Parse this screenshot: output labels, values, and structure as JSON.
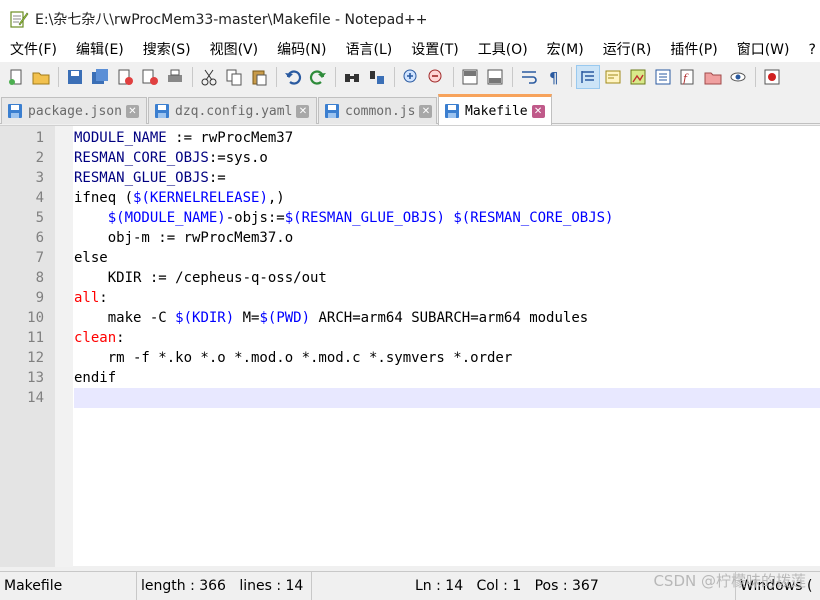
{
  "window": {
    "title": "E:\\杂七杂八\\rwProcMem33-master\\Makefile - Notepad++"
  },
  "menu": [
    {
      "label": "文件(F)"
    },
    {
      "label": "编辑(E)"
    },
    {
      "label": "搜索(S)"
    },
    {
      "label": "视图(V)"
    },
    {
      "label": "编码(N)"
    },
    {
      "label": "语言(L)"
    },
    {
      "label": "设置(T)"
    },
    {
      "label": "工具(O)"
    },
    {
      "label": "宏(M)"
    },
    {
      "label": "运行(R)"
    },
    {
      "label": "插件(P)"
    },
    {
      "label": "窗口(W)"
    },
    {
      "label": "?"
    }
  ],
  "toolbar": [
    {
      "icon": "new-file-icon"
    },
    {
      "icon": "open-folder-icon"
    },
    {
      "icon": "save-icon"
    },
    {
      "icon": "save-all-icon"
    },
    {
      "icon": "close-file-icon"
    },
    {
      "icon": "close-all-icon"
    },
    {
      "icon": "print-icon"
    },
    {
      "icon": "cut-icon"
    },
    {
      "icon": "copy-icon"
    },
    {
      "icon": "paste-icon"
    },
    {
      "icon": "undo-icon"
    },
    {
      "icon": "redo-icon"
    },
    {
      "icon": "find-icon"
    },
    {
      "icon": "replace-icon"
    },
    {
      "icon": "zoom-in-icon"
    },
    {
      "icon": "zoom-out-icon"
    },
    {
      "icon": "sync-vertical-icon"
    },
    {
      "icon": "sync-horizontal-icon"
    },
    {
      "icon": "word-wrap-icon"
    },
    {
      "icon": "show-all-chars-icon"
    },
    {
      "icon": "indent-guide-icon"
    },
    {
      "icon": "language-icon"
    },
    {
      "icon": "doc-map-icon"
    },
    {
      "icon": "function-list-icon"
    },
    {
      "icon": "doc-list-icon"
    },
    {
      "icon": "folder-workspace-icon"
    },
    {
      "icon": "monitoring-icon"
    },
    {
      "icon": "record-macro-icon"
    }
  ],
  "tabs": [
    {
      "label": "package.json",
      "active": false
    },
    {
      "label": "dzq.config.yaml",
      "active": false
    },
    {
      "label": "common.js",
      "active": false
    },
    {
      "label": "Makefile",
      "active": true
    }
  ],
  "editor": {
    "lines": [
      [
        {
          "t": "MODULE_NAME",
          "c": "var"
        },
        {
          "t": " := rwProcMem37",
          "c": "plain"
        }
      ],
      [
        {
          "t": "RESMAN_CORE_OBJS",
          "c": "var"
        },
        {
          "t": ":=sys.o",
          "c": "plain"
        }
      ],
      [
        {
          "t": "RESMAN_GLUE_OBJS",
          "c": "var"
        },
        {
          "t": ":=",
          "c": "plain"
        }
      ],
      [
        {
          "t": "ifneq (",
          "c": "plain"
        },
        {
          "t": "$(KERNELRELEASE)",
          "c": "blue"
        },
        {
          "t": ",)",
          "c": "plain"
        }
      ],
      [
        {
          "t": "    ",
          "c": "plain"
        },
        {
          "t": "$(MODULE_NAME)",
          "c": "blue"
        },
        {
          "t": "-objs:=",
          "c": "plain"
        },
        {
          "t": "$(RESMAN_GLUE_OBJS)",
          "c": "blue"
        },
        {
          "t": " ",
          "c": "plain"
        },
        {
          "t": "$(RESMAN_CORE_OBJS)",
          "c": "blue"
        }
      ],
      [
        {
          "t": "    obj-m := rwProcMem37.o",
          "c": "plain"
        }
      ],
      [
        {
          "t": "else",
          "c": "plain"
        }
      ],
      [
        {
          "t": "    KDIR := /cepheus-q-oss/out",
          "c": "plain"
        }
      ],
      [
        {
          "t": "all",
          "c": "target"
        },
        {
          "t": ":",
          "c": "plain"
        }
      ],
      [
        {
          "t": "    make -C ",
          "c": "plain"
        },
        {
          "t": "$(KDIR)",
          "c": "blue"
        },
        {
          "t": " M=",
          "c": "plain"
        },
        {
          "t": "$(PWD)",
          "c": "blue"
        },
        {
          "t": " ARCH=arm64 SUBARCH=arm64 modules",
          "c": "plain"
        }
      ],
      [
        {
          "t": "clean",
          "c": "target"
        },
        {
          "t": ":",
          "c": "plain"
        }
      ],
      [
        {
          "t": "    rm -f *.ko *.o *.mod.o *.mod.c *.symvers *.order",
          "c": "plain"
        }
      ],
      [
        {
          "t": "endif",
          "c": "plain"
        }
      ],
      [
        {
          "t": "",
          "c": "plain"
        }
      ]
    ],
    "current_line": 14
  },
  "statusbar": {
    "file_type": "Makefile",
    "length": "length : 366",
    "lines": "lines : 14",
    "line": "Ln : 14",
    "col": "Col : 1",
    "pos": "Pos : 367",
    "eol": "Windows (",
    "watermark": "CSDN @柠檬味的拨莲"
  },
  "colors": {
    "var": "#000080",
    "blue": "#0000ff",
    "target": "#ff0000",
    "active_tab_accent": "#f7a35c",
    "current_line_bg": "#e8e8ff"
  }
}
